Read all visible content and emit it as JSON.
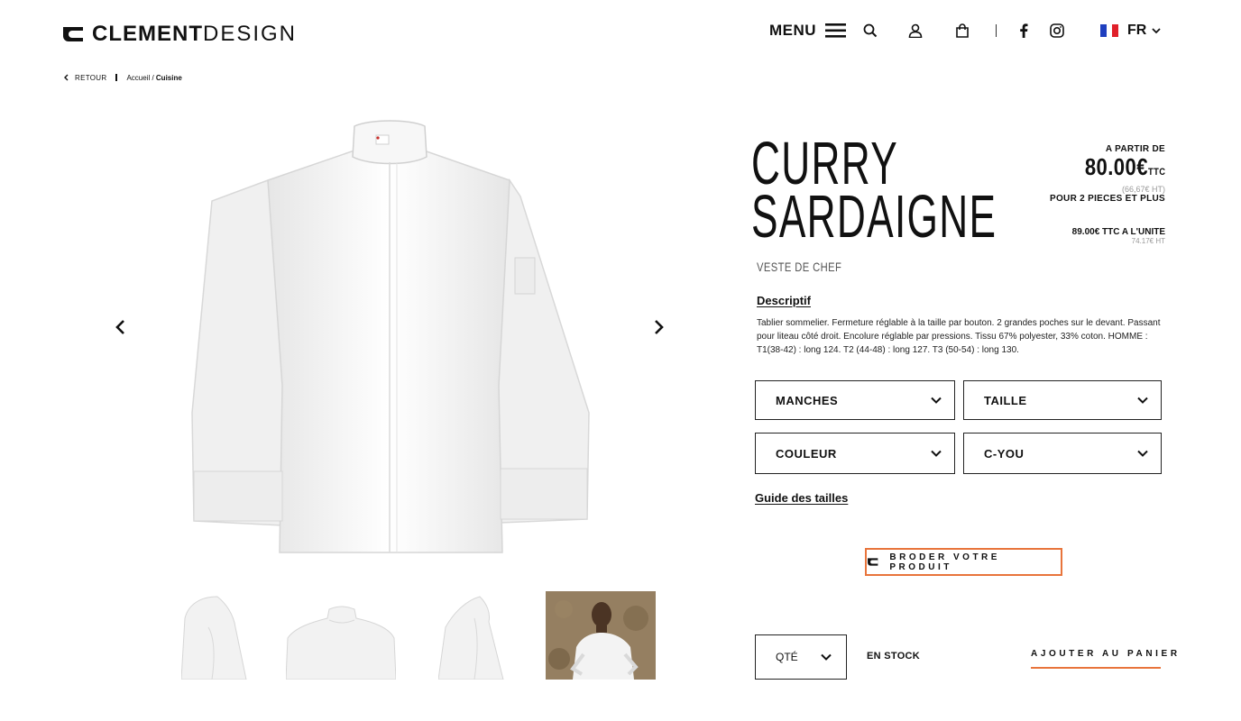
{
  "brand": {
    "name_bold": "CLEMENT",
    "name_light": "DESIGN"
  },
  "header": {
    "menu_label": "MENU",
    "icons": [
      "hamburger-icon",
      "search-icon",
      "user-icon",
      "bag-icon",
      "facebook-icon",
      "instagram-icon"
    ],
    "language": "FR"
  },
  "breadcrumb": {
    "back": "RETOUR",
    "home": "Accueil",
    "separator": " / ",
    "current": "Cuisine"
  },
  "product": {
    "title_line1": "CURRY",
    "title_line2": "SARDAIGNE",
    "subtitle": "VESTE DE CHEF",
    "price_from_label": "A PARTIR DE",
    "price_main": "80.00€",
    "price_main_suffix": "TTC",
    "price_ht": "(66,67€ HT)",
    "price_condition": "POUR 2 PIECES ET PLUS",
    "unit_price": "89.00€ TTC A L'UNITE",
    "unit_price_ht": "74.17€ HT",
    "description_title": "Descriptif",
    "description": "Tablier sommelier. Fermeture réglable à la taille par bouton. 2 grandes poches sur le devant. Passant pour liteau côté droit. Encolure réglable par pressions. Tissu 67% polyester, 33% coton. HOMME : T1(38-42) : long 124. T2 (44-48) : long 127. T3 (50-54) : long 130.",
    "selects": {
      "sleeves": "MANCHES",
      "size": "TAILLE",
      "color": "COULEUR",
      "model": "C-YOU"
    },
    "size_guide": "Guide des tailles",
    "embroider_button": "BRODER VOTRE PRODUIT",
    "quantity_label": "QTÉ",
    "stock_status": "EN STOCK",
    "add_to_cart": "AJOUTER AU PANIER"
  },
  "colors": {
    "accent": "#e8743b",
    "text": "#111111",
    "border": "#222222"
  }
}
